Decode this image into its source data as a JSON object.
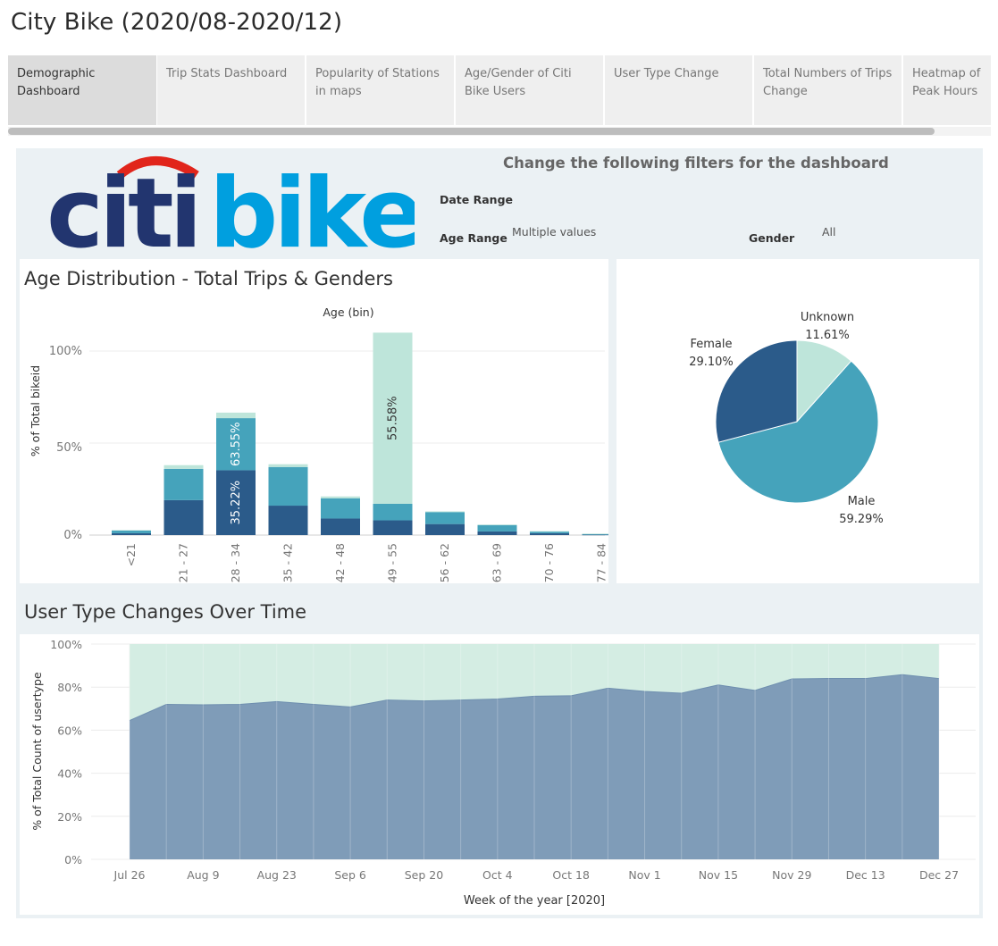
{
  "page": {
    "title": "City Bike (2020/08-2020/12)"
  },
  "tabs": [
    {
      "label": "Demographic Dashboard",
      "active": true
    },
    {
      "label": "Trip Stats Dashboard",
      "active": false
    },
    {
      "label": "Popularity of Stations in maps",
      "active": false
    },
    {
      "label": "Age/Gender of Citi Bike Users",
      "active": false
    },
    {
      "label": "User Type Change",
      "active": false
    },
    {
      "label": "Total Numbers of Trips Change",
      "active": false
    },
    {
      "label": "Heatmap of Peak Hours",
      "active": false
    }
  ],
  "logo": {
    "text_left": "citi",
    "text_right": "bike",
    "colors": {
      "navy": "#22356f",
      "blue": "#009fdf",
      "arc": "#e1251b"
    }
  },
  "filters": {
    "heading": "Change the following filters for the dashboard",
    "date_range_label": "Date Range",
    "age_range_label": "Age Range",
    "age_range_value": "Multiple values",
    "gender_label": "Gender",
    "gender_value": "All"
  },
  "colors": {
    "male": "#45a3bb",
    "female": "#2b5b8a",
    "unknown": "#bee5da",
    "subscriber": "#7f9cb8",
    "customer": "#d4ede3"
  },
  "charts": {
    "age_distribution": {
      "title": "Age Distribution - Total Trips & Genders",
      "column_header": "Age (bin)",
      "ylabel": "% of Total bikeid",
      "yticks": [
        "100%",
        "50%",
        "0%"
      ],
      "labels": [
        "63.55%",
        "35.22%",
        "55.58%"
      ]
    },
    "gender_pie": {
      "slices": [
        {
          "name": "Unknown",
          "label": "11.61%"
        },
        {
          "name": "Male",
          "label": "59.29%"
        },
        {
          "name": "Female",
          "label": "29.10%"
        }
      ]
    },
    "user_type": {
      "title": "User Type Changes Over Time",
      "ylabel": "% of Total Count of usertype",
      "xlabel": "Week of the year [2020]",
      "yticks": [
        "100%",
        "80%",
        "60%",
        "40%",
        "20%",
        "0%"
      ],
      "xticks": [
        "Jul 26",
        "Aug 9",
        "Aug 23",
        "Sep 6",
        "Sep 20",
        "Oct 4",
        "Oct 18",
        "Nov 1",
        "Nov 15",
        "Nov 29",
        "Dec 13",
        "Dec 27"
      ]
    }
  },
  "chart_data": [
    {
      "type": "bar",
      "title": "Age Distribution - Total Trips & Genders",
      "xlabel": "Age (bin)",
      "ylabel": "% of Total bikeid",
      "ylim": [
        0,
        100
      ],
      "categories": [
        "<21",
        "21 - 27",
        "28 - 34",
        "35 - 42",
        "42 - 48",
        "49 - 55",
        "56 - 62",
        "63 - 69",
        "70 - 76",
        "77 - 84"
      ],
      "series": [
        {
          "values": [
            1.0,
            19.0,
            35.22,
            16.0,
            9.0,
            8.0,
            6.0,
            2.0,
            1.0,
            0.2
          ]
        },
        {
          "values": [
            1.5,
            17.0,
            28.33,
            21.0,
            11.0,
            9.0,
            6.5,
            3.5,
            1.0,
            0.3
          ]
        },
        {
          "values": [
            0.2,
            2.0,
            3.0,
            1.5,
            1.0,
            93.0,
            0.4,
            0.2,
            0.1,
            0.3
          ]
        }
      ]
    },
    {
      "type": "pie",
      "slices": [
        {
          "name": "Unknown",
          "value": 11.61
        },
        {
          "name": "Male",
          "value": 59.29
        },
        {
          "name": "Female",
          "value": 29.1
        }
      ]
    },
    {
      "type": "area",
      "title": "User Type Changes Over Time",
      "xlabel": "Week of the year [2020]",
      "ylabel": "% of Total Count of usertype",
      "ylim": [
        0,
        100
      ],
      "x": [
        "Jul 26",
        "Aug 2",
        "Aug 9",
        "Aug 16",
        "Aug 23",
        "Aug 30",
        "Sep 6",
        "Sep 13",
        "Sep 20",
        "Sep 27",
        "Oct 4",
        "Oct 11",
        "Oct 18",
        "Oct 25",
        "Nov 1",
        "Nov 8",
        "Nov 15",
        "Nov 22",
        "Nov 29",
        "Dec 6",
        "Dec 13",
        "Dec 20",
        "Dec 27"
      ],
      "series": [
        {
          "values": [
            64.5,
            72.0,
            71.8,
            72.0,
            73.3,
            72.0,
            70.8,
            74.0,
            73.6,
            74.0,
            74.5,
            75.8,
            76.0,
            79.5,
            78.0,
            77.2,
            81.0,
            78.5,
            83.8,
            84.0,
            84.0,
            85.8,
            84.0
          ]
        },
        {
          "values": [
            35.5,
            28.0,
            28.2,
            28.0,
            26.7,
            28.0,
            29.2,
            26.0,
            26.4,
            26.0,
            25.5,
            24.2,
            24.0,
            20.5,
            22.0,
            22.8,
            19.0,
            21.5,
            16.2,
            16.0,
            16.0,
            14.2,
            16.0
          ]
        }
      ]
    }
  ]
}
